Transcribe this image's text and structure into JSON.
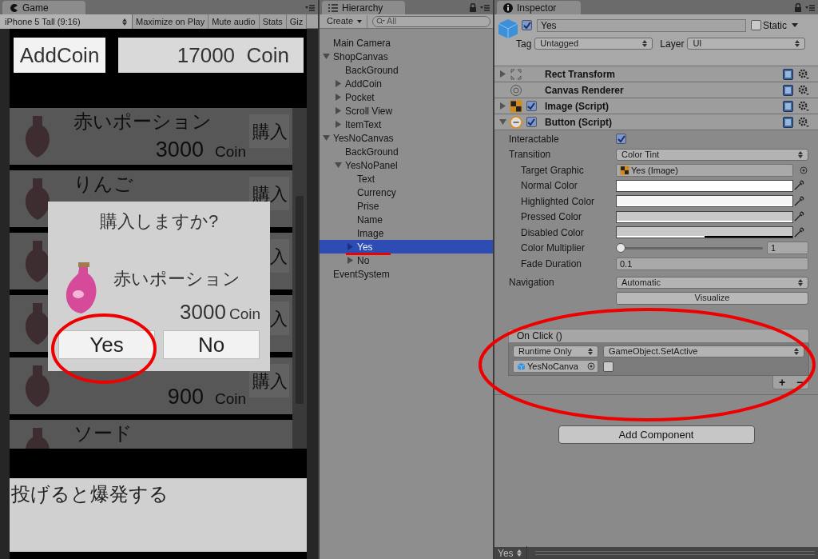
{
  "game": {
    "tab": "Game",
    "toolbar": {
      "aspect": "iPhone 5 Tall (9:16)",
      "toggles": [
        {
          "label": "Maximize on Play",
          "on": false
        },
        {
          "label": "Mute audio",
          "on": false
        },
        {
          "label": "Stats",
          "on": false
        },
        {
          "label": "Giz",
          "on": false
        }
      ]
    },
    "add_coin": "AddCoin",
    "coins": "17000  Coin",
    "items": [
      {
        "name": "赤いポーション",
        "price": "3000",
        "unit": "Coin",
        "buy": "購入"
      },
      {
        "name": "りんご",
        "buy": "購入"
      },
      {
        "buy": "入"
      },
      {
        "buy": "入"
      },
      {
        "price": "900",
        "unit": "Coin",
        "buy": "購入"
      },
      {
        "name": "ソード"
      }
    ],
    "dialog": {
      "title": "購入しますか?",
      "item_name": "赤いポーション",
      "price": "3000",
      "unit": "Coin",
      "buttons": [
        "Yes",
        "No"
      ]
    },
    "description": "投げると爆発する"
  },
  "hierarchy": {
    "tab": "Hierarchy",
    "create": "Create",
    "search_placeholder": "All",
    "tree": [
      {
        "label": "Main Camera",
        "selected": false
      },
      {
        "label": "ShopCanvas",
        "selected": false,
        "expanded": true,
        "children": [
          {
            "label": "BackGround",
            "selected": false
          },
          {
            "label": "AddCoin",
            "selected": false,
            "expanded": false
          },
          {
            "label": "Pocket",
            "selected": false,
            "expanded": false
          },
          {
            "label": "Scroll View",
            "selected": false,
            "expanded": false
          },
          {
            "label": "ItemText",
            "selected": false,
            "expanded": false
          }
        ]
      },
      {
        "label": "YesNoCanvas",
        "selected": false,
        "expanded": true,
        "children": [
          {
            "label": "BackGround",
            "selected": false
          },
          {
            "label": "YesNoPanel",
            "selected": false,
            "expanded": true,
            "children": [
              {
                "label": "Text",
                "selected": false
              },
              {
                "label": "Currency",
                "selected": false
              },
              {
                "label": "Prise",
                "selected": false
              },
              {
                "label": "Name",
                "selected": false
              },
              {
                "label": "Image",
                "selected": false
              },
              {
                "label": "Yes",
                "selected": true,
                "expanded": false
              },
              {
                "label": "No",
                "selected": false,
                "expanded": false
              }
            ]
          }
        ]
      },
      {
        "label": "EventSystem",
        "selected": false
      }
    ]
  },
  "inspector": {
    "tab": "Inspector",
    "object": {
      "active": true,
      "name": "Yes",
      "static": false,
      "static_label": "Static",
      "tag_label": "Tag",
      "tag": "Untagged",
      "layer_label": "Layer",
      "layer": "UI"
    },
    "components": [
      {
        "kind": "rect_transform",
        "title": "Rect Transform",
        "expanded": false
      },
      {
        "kind": "canvas_renderer",
        "title": "Canvas Renderer"
      },
      {
        "kind": "image",
        "title": "Image (Script)",
        "expanded": false,
        "enabled": true
      },
      {
        "kind": "button",
        "title": "Button (Script)",
        "expanded": true,
        "enabled": true,
        "properties": [
          {
            "kind": "toggle",
            "label": "Interactable",
            "checked": true
          },
          {
            "kind": "dropdown",
            "label": "Transition",
            "value": "Color Tint",
            "children": [
              {
                "kind": "object",
                "label": "Target Graphic",
                "value": "Yes (Image)"
              },
              {
                "kind": "color",
                "label": "Normal Color",
                "color": "#ffffff",
                "level": 1
              },
              {
                "kind": "color",
                "label": "Highlighted Color",
                "color": "#f5f5f5",
                "level": 1
              },
              {
                "kind": "color",
                "label": "Pressed Color",
                "color": "#c8c8c8",
                "level": 1
              },
              {
                "kind": "color",
                "label": "Disabled Color",
                "color": "#c8c8c8",
                "level": 0.5
              },
              {
                "kind": "slider",
                "label": "Color Multiplier",
                "level": 0,
                "reading": "1"
              },
              {
                "kind": "number",
                "label": "Fade Duration",
                "value": "0.1"
              }
            ]
          }
        ],
        "navigation": {
          "label": "Navigation",
          "value": "Automatic",
          "visualize": "Visualize"
        },
        "on_click": {
          "title": "On Click ()",
          "entries": [
            {
              "runtime": "Runtime Only",
              "function": "GameObject.SetActive",
              "target": "YesNoCanva",
              "argument_checked": false
            }
          ],
          "add": "+",
          "remove": "−"
        }
      }
    ],
    "add_component": "Add Component",
    "status": "Yes"
  }
}
